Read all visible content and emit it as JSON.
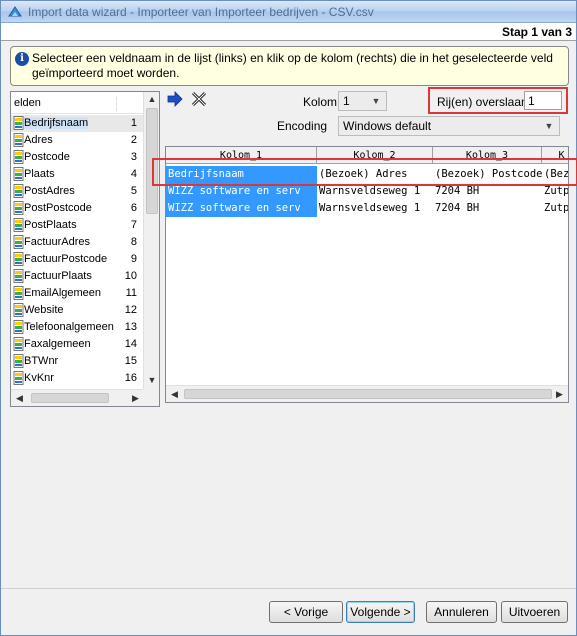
{
  "window": {
    "title": "Import data wizard - Importeer van Importeer bedrijven - CSV.csv",
    "step": "Stap 1 van 3"
  },
  "info": {
    "text": "Selecteer een veldnaam in de lijst (links) en klik op de kolom (rechts) die in het geselecteerde veld geïmporteerd moet worden."
  },
  "fieldlist": {
    "header": "elden",
    "items": [
      {
        "name": "Bedrijfsnaam",
        "num": "1"
      },
      {
        "name": "Adres",
        "num": "2"
      },
      {
        "name": "Postcode",
        "num": "3"
      },
      {
        "name": "Plaats",
        "num": "4"
      },
      {
        "name": "PostAdres",
        "num": "5"
      },
      {
        "name": "PostPostcode",
        "num": "6"
      },
      {
        "name": "PostPlaats",
        "num": "7"
      },
      {
        "name": "FactuurAdres",
        "num": "8"
      },
      {
        "name": "FactuurPostcode",
        "num": "9"
      },
      {
        "name": "FactuurPlaats",
        "num": "10"
      },
      {
        "name": "EmailAlgemeen",
        "num": "11"
      },
      {
        "name": "Website",
        "num": "12"
      },
      {
        "name": "Telefoonalgemeen",
        "num": "13"
      },
      {
        "name": "Faxalgemeen",
        "num": "14"
      },
      {
        "name": "BTWnr",
        "num": "15"
      },
      {
        "name": "KvKnr",
        "num": "16"
      }
    ]
  },
  "options": {
    "kolom_label": "Kolom",
    "kolom_value": "1",
    "skip_label": "Rij(en) overslaan",
    "skip_value": "1",
    "encoding_label": "Encoding",
    "encoding_value": "Windows default"
  },
  "grid": {
    "columns": [
      "Kolom_1",
      "Kolom_2",
      "Kolom_3",
      "K"
    ],
    "rows": [
      [
        "Bedrijfsnaam",
        "(Bezoek) Adres",
        "(Bezoek) Postcode",
        "(Bez"
      ],
      [
        "WIZZ software en serv",
        "Warnsveldseweg 1",
        "7204 BH",
        "Zutp"
      ],
      [
        "WIZZ software en serv",
        "Warnsveldseweg 1",
        "7204 BH",
        "Zutp"
      ]
    ]
  },
  "buttons": {
    "prev": "< Vorige",
    "next": "Volgende >",
    "cancel": "Annuleren",
    "run": "Uitvoeren"
  },
  "colors": {
    "highlight": "#d9383a",
    "selection": "#3399ff",
    "info_bg": "#ffffe1"
  }
}
